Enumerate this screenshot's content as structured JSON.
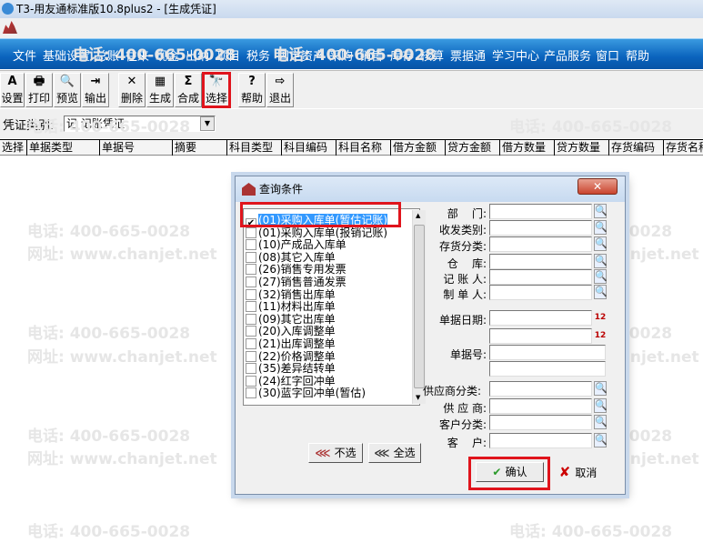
{
  "window": {
    "title": "T3-用友通标准版10.8plus2 - [生成凭证]"
  },
  "watermark": {
    "phone": "电话: 400-665-0028",
    "site": "网址: www.chanjet.net"
  },
  "menu": [
    "文件",
    "基础设置",
    "总账",
    "往来",
    "现金",
    "出纳",
    "项目",
    "税务",
    "固定资产",
    "采购",
    "销售",
    "库存",
    "核算",
    "票据通",
    "学习中心",
    "产品服务",
    "窗口",
    "帮助"
  ],
  "toolbar": [
    {
      "label": "设置",
      "icon": "setup-icon",
      "glyph": "A"
    },
    {
      "label": "打印",
      "icon": "printer-icon",
      "glyph": "🖶"
    },
    {
      "label": "预览",
      "icon": "preview-icon",
      "glyph": "🔍"
    },
    {
      "label": "输出",
      "icon": "export-icon",
      "glyph": "⇥"
    },
    {
      "label": "删除",
      "icon": "delete-icon",
      "glyph": "✕"
    },
    {
      "label": "生成",
      "icon": "generate-icon",
      "glyph": "▦"
    },
    {
      "label": "合成",
      "icon": "sum-icon",
      "glyph": "Σ"
    },
    {
      "label": "选择",
      "icon": "binoculars-icon",
      "glyph": "🔭"
    },
    {
      "label": "帮助",
      "icon": "help-icon",
      "glyph": "?"
    },
    {
      "label": "退出",
      "icon": "exit-icon",
      "glyph": "⇨"
    }
  ],
  "voucher": {
    "label": "凭证类别:",
    "value": "记 记账凭证"
  },
  "table": {
    "columns": [
      "选择",
      "单据类型",
      "单据号",
      "摘要",
      "科目类型",
      "科目编码",
      "科目名称",
      "借方金额",
      "贷方金额",
      "借方数量",
      "贷方数量",
      "存货编码",
      "存货名称"
    ]
  },
  "dialog": {
    "title": "查询条件",
    "close": "✕",
    "items": [
      {
        "label": "(01)采购入库单(暂估记账)",
        "checked": true
      },
      {
        "label": "(01)采购入库单(报销记账)",
        "checked": false
      },
      {
        "label": "(10)产成品入库单",
        "checked": false
      },
      {
        "label": "(08)其它入库单",
        "checked": false
      },
      {
        "label": "(26)销售专用发票",
        "checked": false
      },
      {
        "label": "(27)销售普通发票",
        "checked": false
      },
      {
        "label": "(32)销售出库单",
        "checked": false
      },
      {
        "label": "(11)材料出库单",
        "checked": false
      },
      {
        "label": "(09)其它出库单",
        "checked": false
      },
      {
        "label": "(20)入库调整单",
        "checked": false
      },
      {
        "label": "(21)出库调整单",
        "checked": false
      },
      {
        "label": "(22)价格调整单",
        "checked": false
      },
      {
        "label": "(35)差异结转单",
        "checked": false
      },
      {
        "label": "(24)红字回冲单",
        "checked": false
      },
      {
        "label": "(30)蓝字回冲单(暂估)",
        "checked": false
      }
    ],
    "deselect": "不选",
    "select_all": "全选",
    "fields": {
      "dept": "部    门:",
      "rd_type": "收发类别:",
      "inv_class": "存货分类:",
      "warehouse": "仓    库:",
      "bookkeeper": "记 账 人:",
      "maker": "制 单 人:",
      "date": "单据日期:",
      "doc_no": "单据号:",
      "vendor_class": "供应商分类:",
      "vendor": "供 应 商:",
      "cust_class": "客户分类:",
      "customer": "客    户:"
    },
    "ok": "确认",
    "cancel": "取消"
  }
}
